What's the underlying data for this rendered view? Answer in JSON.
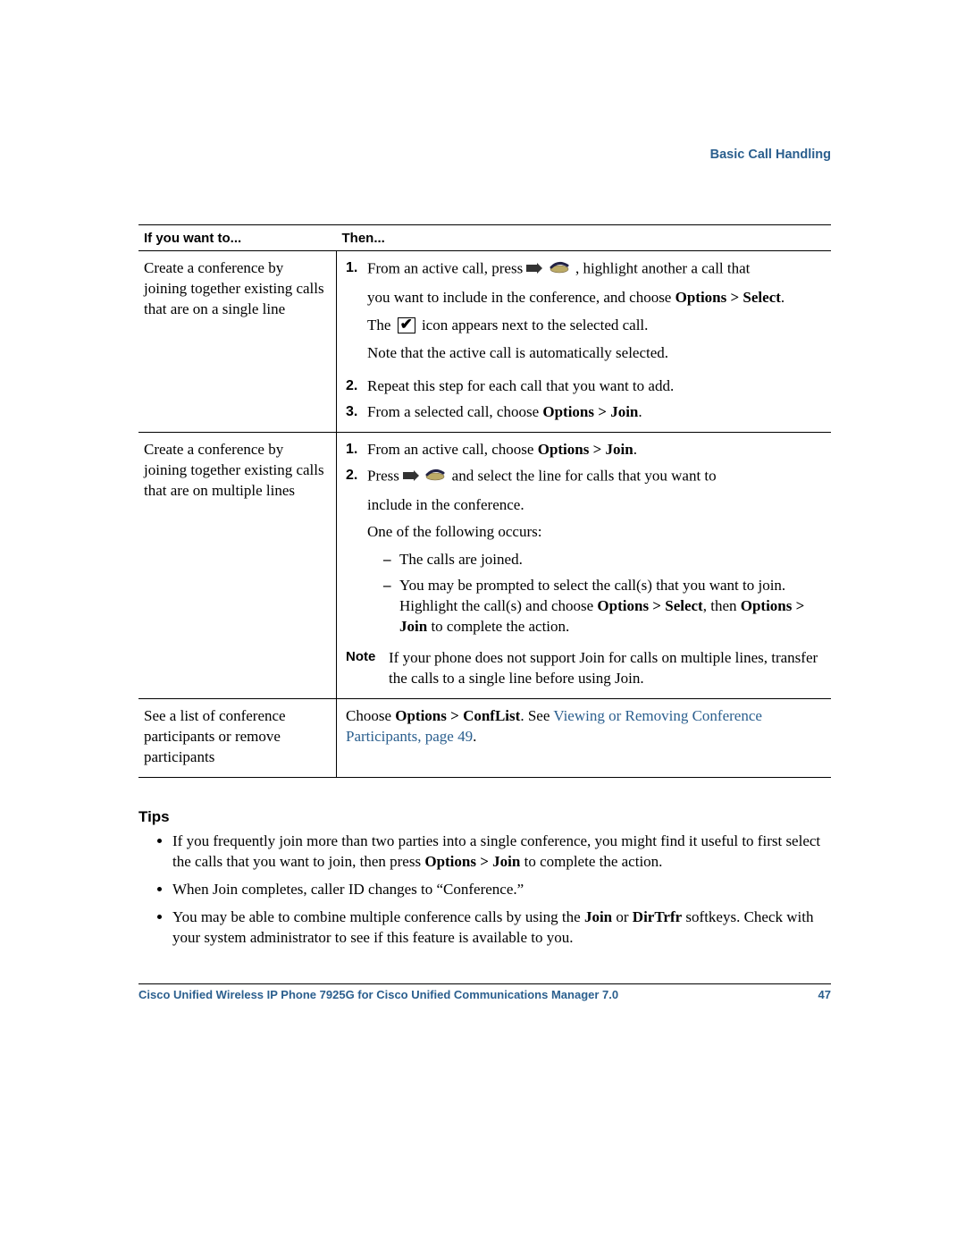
{
  "section_header": "Basic Call Handling",
  "table": {
    "headers": {
      "left": "If you want to...",
      "right": "Then..."
    },
    "rows": [
      {
        "left": "Create a conference by joining together existing calls that are on a single line",
        "steps": {
          "s1a": "From an active call, press ",
          "s1b": " , highlight another a call that",
          "s1c_a": "you want to include in the conference, and choose ",
          "s1c_opt": "Options > Select",
          "s1c_b": ".",
          "s1d_a": "The ",
          "s1d_b": " icon appears next to the selected call.",
          "s1e": "Note that the active call is automatically selected.",
          "s2": "Repeat this step for each call that you want to add.",
          "s3a": "From a selected call, choose ",
          "s3b": "Options > Join",
          "s3c": "."
        }
      },
      {
        "left": "Create a conference by joining together existing calls that are on multiple lines",
        "steps": {
          "s1a": "From an active call, choose ",
          "s1b": "Options > Join",
          "s1c": ".",
          "s2a": "Press ",
          "s2b": " and select the line for calls that you want to",
          "s2c": "include in the conference.",
          "s2d": "One of the following occurs:",
          "d1": "The calls are joined.",
          "d2a": "You may be prompted to select the call(s) that you want to join. Highlight the call(s) and choose ",
          "d2b": "Options > Select",
          "d2c": ", then ",
          "d2d": "Options > Join",
          "d2e": " to complete the action.",
          "note": "If your phone does not support Join for calls on multiple lines, transfer the calls to a single line before using Join."
        }
      },
      {
        "left": "See a list of conference participants or remove participants",
        "text_a": "Choose ",
        "text_b": "Options > ConfList",
        "text_c": ". See ",
        "link": "Viewing or Removing Conference Participants, page 49",
        "text_d": "."
      }
    ]
  },
  "tips_heading": "Tips",
  "tips": [
    {
      "a": "If you frequently join more than two parties into a single conference, you might find it useful to first select the calls that you want to join, then press ",
      "b": "Options > Join",
      "c": " to complete the action."
    },
    {
      "a": "When Join completes, caller ID changes to “Conference.”"
    },
    {
      "a": "You may be able to combine multiple conference calls by using the ",
      "b": "Join",
      "c": " or ",
      "d": "DirTrfr",
      "e": " softkeys. Check with your system administrator to see if this feature is available to you."
    }
  ],
  "note_label": "Note",
  "footer": {
    "title": "Cisco Unified Wireless IP Phone 7925G for Cisco Unified Communications Manager 7.0",
    "page": "47"
  }
}
